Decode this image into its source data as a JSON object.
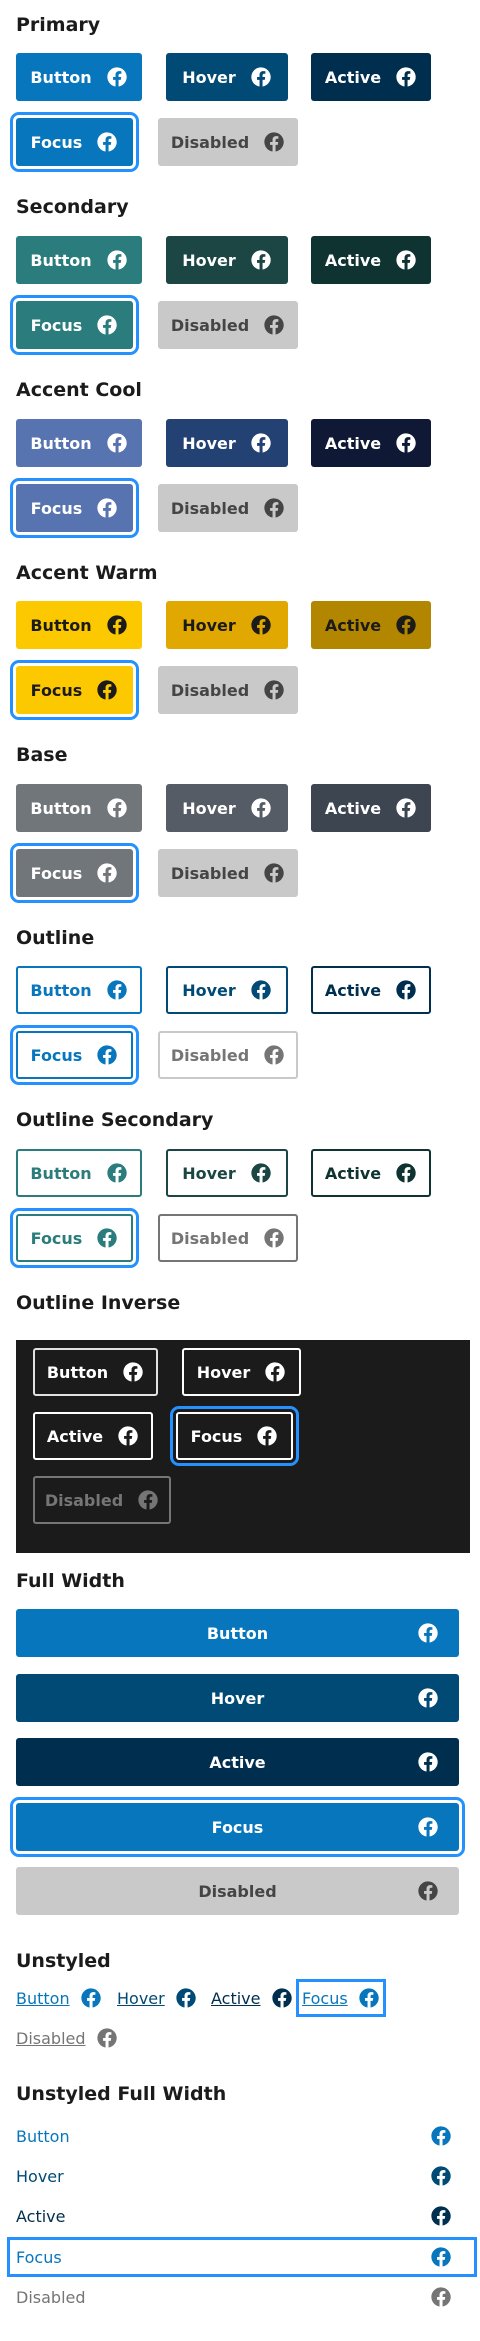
{
  "colors": {
    "focus_ring": "#2491ff",
    "disabled_bg": "#c9c9c9",
    "disabled_text": "#454545",
    "primary": "#0876bd",
    "primary_hover": "#014a75",
    "primary_active": "#002e4f",
    "secondary": "#2a7d7c",
    "secondary_hover": "#1b4644",
    "secondary_active": "#0f3331",
    "accent_cool": "#5773b0",
    "accent_cool_hover": "#234173",
    "accent_cool_active": "#0f1935",
    "accent_warm": "#fcc800",
    "accent_warm_hover": "#e0a800",
    "accent_warm_active": "#b38600",
    "base": "#71767a",
    "base_hover": "#565c65",
    "base_active": "#3d4551",
    "inverse_panel": "#1b1b1b"
  },
  "icon": "facebook-icon",
  "labels": {
    "button": "Button",
    "hover": "Hover",
    "active": "Active",
    "focus": "Focus",
    "disabled": "Disabled"
  },
  "sections": {
    "primary": "Primary",
    "secondary": "Secondary",
    "accent_cool": "Accent Cool",
    "accent_warm": "Accent Warm",
    "base": "Base",
    "outline": "Outline",
    "outline_secondary": "Outline Secondary",
    "outline_inverse": "Outline Inverse",
    "full_width": "Full Width",
    "unstyled": "Unstyled",
    "unstyled_full_width": "Unstyled Full Width"
  }
}
